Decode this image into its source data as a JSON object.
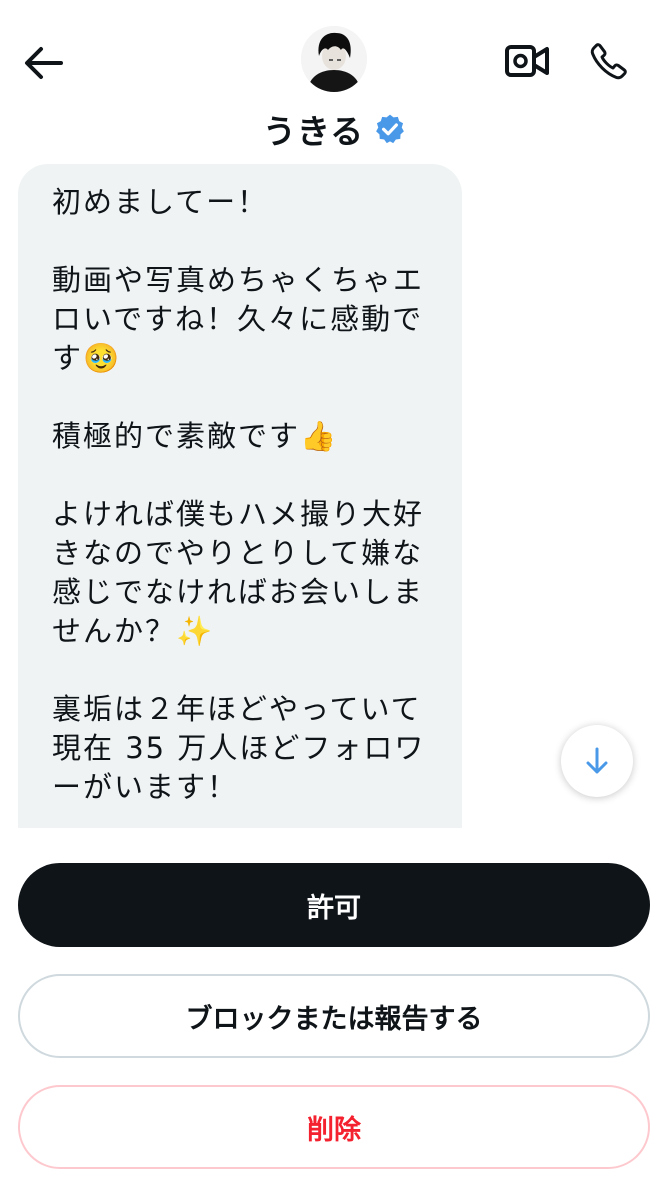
{
  "header": {
    "back_icon": "arrow-left-icon",
    "avatar_icon": "avatar-image",
    "video_icon": "video-camera-icon",
    "call_icon": "phone-icon",
    "name": "うきる",
    "verified_icon": "verified-badge-icon",
    "verified_color": "#4a99e9"
  },
  "message": {
    "text": "初めましてー！\n\n動画や写真めちゃくちゃエロいですね！久々に感動です🥹\n\n積極的で素敵です👍\n\nよければ僕もハメ撮り大好きなのでやりとりして嫌な感じでなければお会いしませんか？✨\n\n裏垢は２年ほどやっていて現在 35 万人ほどフォロワーがいます！",
    "bubble_color": "#eff3f4"
  },
  "scroll_down_icon": "arrow-down-icon",
  "actions": {
    "accept_label": "許可",
    "block_label": "ブロックまたは報告する",
    "delete_label": "削除",
    "delete_color": "#f4212e"
  }
}
